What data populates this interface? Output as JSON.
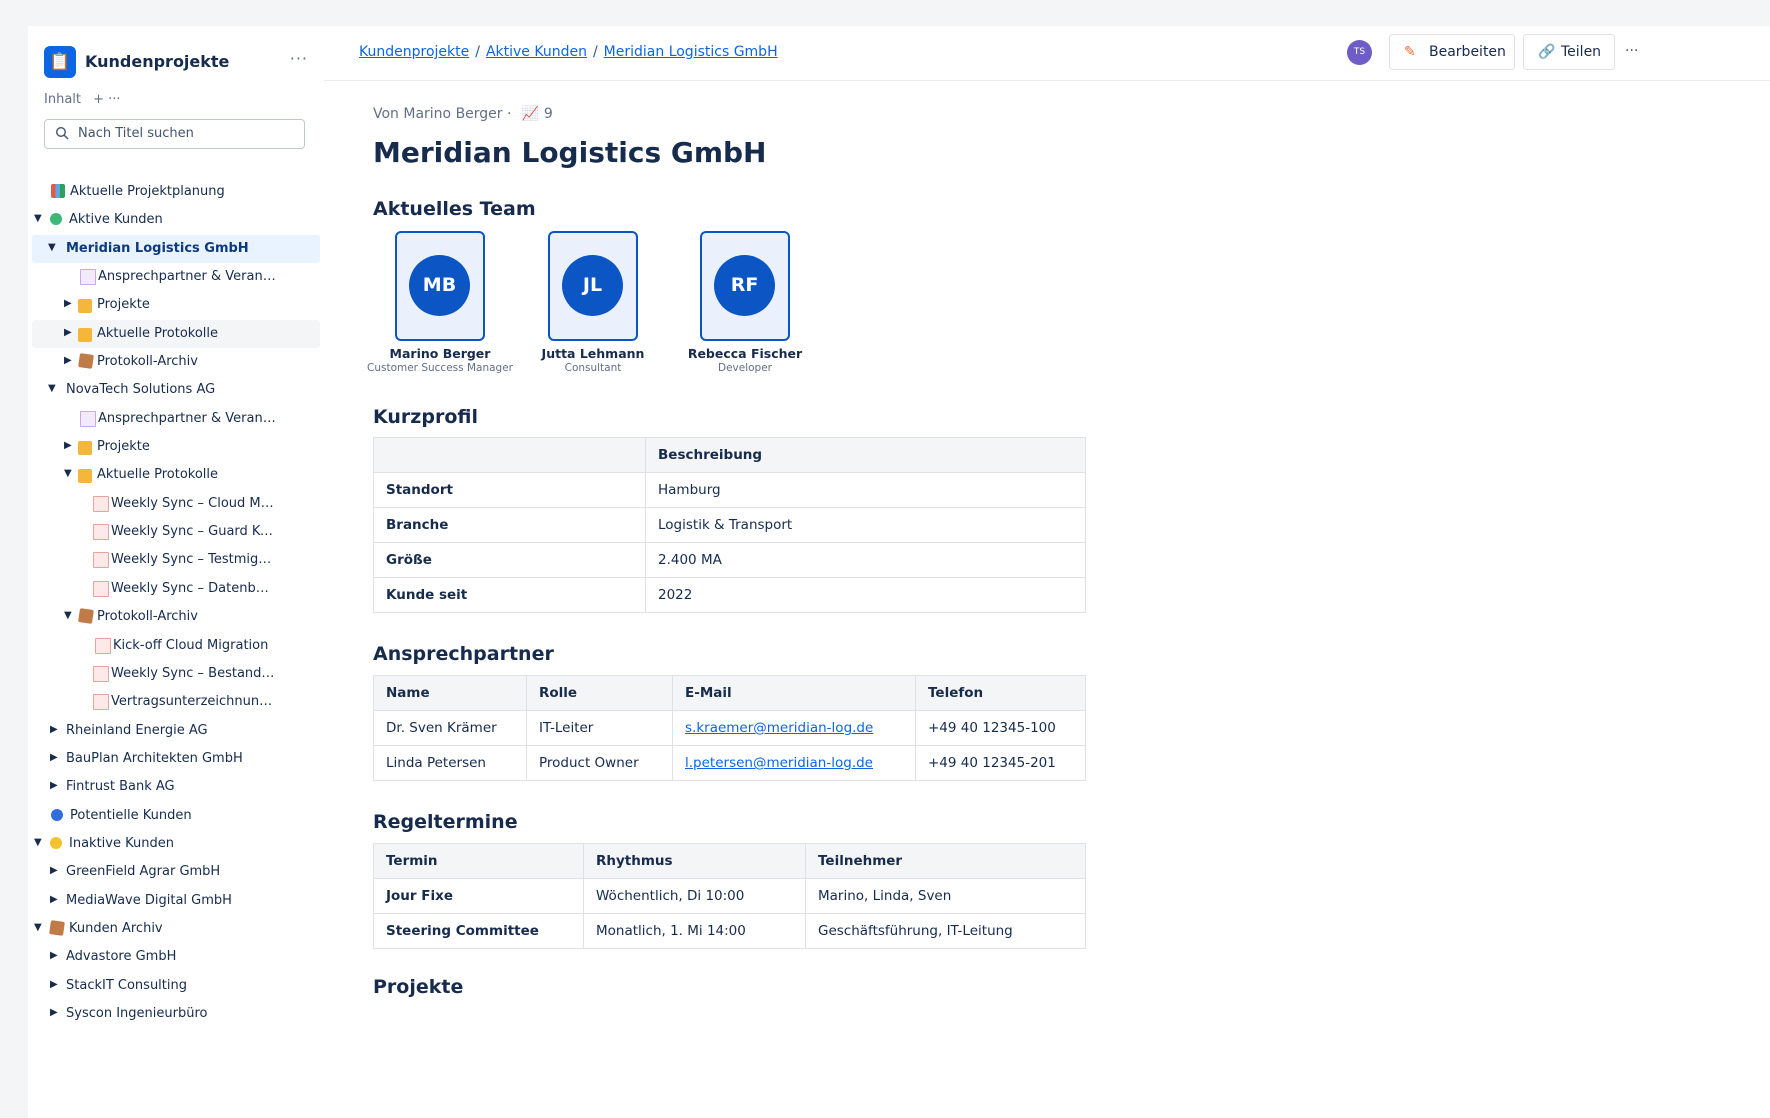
{
  "sidebar": {
    "space_title": "Kundenprojekte",
    "more": "···",
    "content_label": "Inhalt",
    "content_actions": "+ ···",
    "search_placeholder": "Nach Titel suchen",
    "tree": [
      {
        "label": "Aktuelle Projektplanung",
        "icon": "chart-icon"
      },
      {
        "label": "Aktive Kunden",
        "icon": "green-circle-icon",
        "expanded": true
      },
      {
        "label": "Meridian Logistics GmbH",
        "expanded": true,
        "selected": true
      },
      {
        "label": "Ansprechpartner & Verantwortl...",
        "icon": "page-icon"
      },
      {
        "label": "Projekte",
        "icon": "folder-icon"
      },
      {
        "label": "Aktuelle Protokolle",
        "icon": "folder-icon"
      },
      {
        "label": "Protokoll-Archiv",
        "icon": "package-icon"
      },
      {
        "label": "NovaTech Solutions AG",
        "expanded": true
      },
      {
        "label": "Ansprechpartner & Verantwortl...",
        "icon": "page-icon"
      },
      {
        "label": "Projekte",
        "icon": "folder-icon"
      },
      {
        "label": "Aktuelle Protokolle",
        "icon": "folder-icon",
        "expanded": true
      },
      {
        "label": "Weekly Sync – Cloud Migrati...",
        "icon": "memo-icon"
      },
      {
        "label": "Weekly Sync – Guard Konfig...",
        "icon": "memo-icon"
      },
      {
        "label": "Weekly Sync – Testmigration ...",
        "icon": "memo-icon"
      },
      {
        "label": "Weekly Sync – Datenbereini...",
        "icon": "memo-icon"
      },
      {
        "label": "Protokoll-Archiv",
        "icon": "package-icon",
        "expanded": true
      },
      {
        "label": "Kick-off Cloud Migration",
        "icon": "memo-icon"
      },
      {
        "label": "Weekly Sync – Bestandsaufn...",
        "icon": "memo-icon"
      },
      {
        "label": "Vertragsunterzeichnung & O...",
        "icon": "memo-icon"
      },
      {
        "label": "Rheinland Energie AG"
      },
      {
        "label": "BauPlan Architekten GmbH"
      },
      {
        "label": "Fintrust Bank AG"
      },
      {
        "label": "Potentielle Kunden",
        "icon": "blue-circle-icon"
      },
      {
        "label": "Inaktive Kunden",
        "icon": "yellow-circle-icon",
        "expanded": true
      },
      {
        "label": "GreenField Agrar GmbH"
      },
      {
        "label": "MediaWave Digital GmbH"
      },
      {
        "label": "Kunden Archiv",
        "icon": "package-icon",
        "expanded": true
      },
      {
        "label": "Advastore GmbH"
      },
      {
        "label": "StackIT Consulting"
      },
      {
        "label": "Syscon Ingenieurbüro"
      }
    ]
  },
  "header": {
    "breadcrumb": [
      "Kundenprojekte",
      "Aktive Kunden",
      "Meridian Logistics GmbH"
    ],
    "avatar_initials": "TS",
    "edit_label": "Bearbeiten",
    "share_label": "Teilen",
    "more": "···"
  },
  "page": {
    "byline": "Von Marino Berger ·",
    "views": "9",
    "title": "Meridian Logistics GmbH",
    "team_heading": "Aktuelles Team",
    "team": [
      {
        "initials": "MB",
        "name": "Marino Berger",
        "role": "Customer Success Manager"
      },
      {
        "initials": "JL",
        "name": "Jutta Lehmann",
        "role": "Consultant"
      },
      {
        "initials": "RF",
        "name": "Rebecca Fischer",
        "role": "Developer"
      }
    ],
    "profile_heading": "Kurzprofil",
    "profile_header": [
      "",
      "Beschreibung"
    ],
    "profile_rows": [
      [
        "Standort",
        "Hamburg"
      ],
      [
        "Branche",
        "Logistik & Transport"
      ],
      [
        "Größe",
        "2.400 MA"
      ],
      [
        "Kunde seit",
        "2022"
      ]
    ],
    "contacts_heading": "Ansprechpartner",
    "contacts_header": [
      "Name",
      "Rolle",
      "E-Mail",
      "Telefon"
    ],
    "contacts_rows": [
      [
        "Dr. Sven Krämer",
        "IT-Leiter",
        "s.kraemer@meridian-log.de",
        "+49 40 12345-100"
      ],
      [
        "Linda Petersen",
        "Product Owner",
        "l.petersen@meridian-log.de",
        "+49 40 12345-201"
      ]
    ],
    "meetings_heading": "Regeltermine",
    "meetings_header": [
      "Termin",
      "Rhythmus",
      "Teilnehmer"
    ],
    "meetings_rows": [
      [
        "Jour Fixe",
        "Wöchentlich, Di 10:00",
        "Marino, Linda, Sven"
      ],
      [
        "Steering Committee",
        "Monatlich, 1. Mi 14:00",
        "Geschäftsführung, IT-Leitung"
      ]
    ],
    "projects_heading": "Projekte"
  }
}
